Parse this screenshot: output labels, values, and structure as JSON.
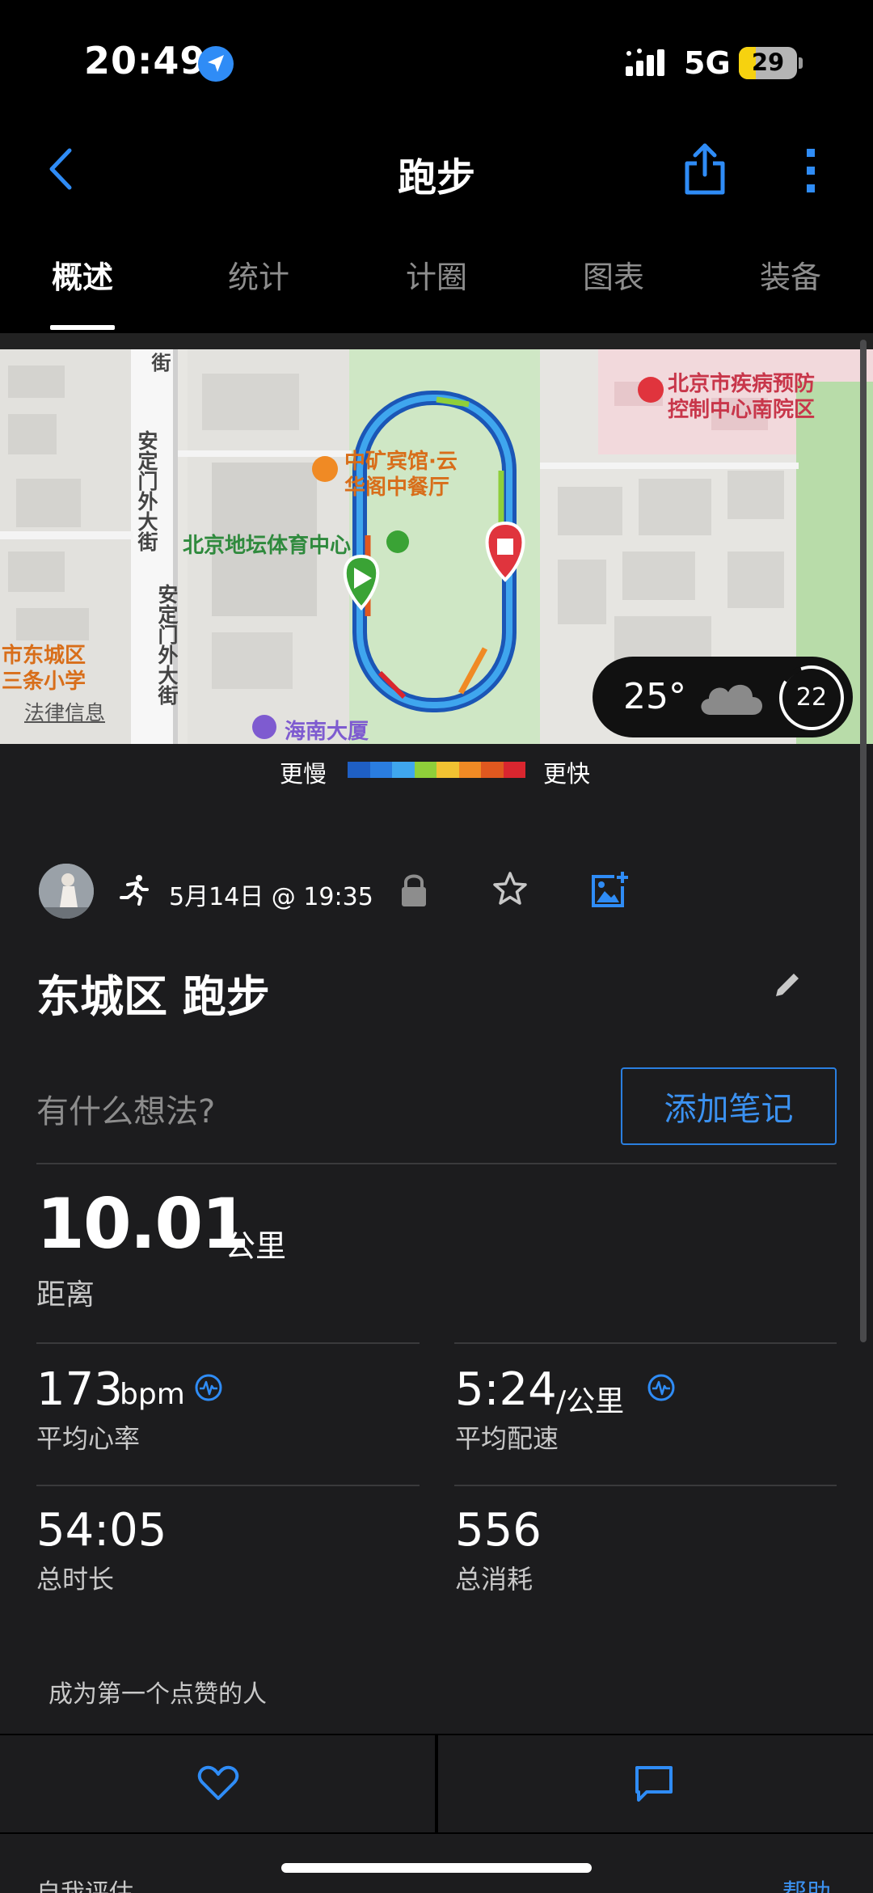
{
  "status_bar": {
    "time": "20:49",
    "network": "5G",
    "battery": "29",
    "battery_level": 0.29
  },
  "header": {
    "title": "跑步",
    "back_icon": "chevron-left-icon",
    "share_icon": "share-icon",
    "more_icon": "more-vertical-icon"
  },
  "tabs": [
    {
      "label": "概述",
      "active": true
    },
    {
      "label": "统计",
      "active": false
    },
    {
      "label": "计圈",
      "active": false
    },
    {
      "label": "图表",
      "active": false
    },
    {
      "label": "装备",
      "active": false
    }
  ],
  "map": {
    "labels": {
      "street_1": "安定门外大街",
      "street_2": "安定门外大街",
      "street_top": "街",
      "hotel": "中矿宾馆·云华阁中餐厅",
      "hotel_line1": "中矿宾馆·云",
      "hotel_line2": "华阁中餐厅",
      "stadium": "北京地坛体育中心",
      "cdc_line1": "北京市疾病预防",
      "cdc_line2": "控制中心南院区",
      "school_line1": "市东城区",
      "school_line2": "三条小学",
      "building": "海南大厦"
    },
    "legal": "法律信息",
    "weather": {
      "temp": "25°",
      "aqi": "22",
      "icon": "cloud-icon"
    }
  },
  "legend": {
    "slow": "更慢",
    "fast": "更快",
    "colors": [
      "#1f5fc4",
      "#2a7de0",
      "#3fa6ee",
      "#8fcf3a",
      "#f1c232",
      "#f08a24",
      "#e0581f",
      "#d9262f"
    ]
  },
  "activity": {
    "date": "5月14日 @ 19:35",
    "title": "东城区 跑步",
    "note_placeholder": "有什么想法?",
    "add_note": "添加笔记"
  },
  "stats": {
    "distance": {
      "value": "10.01",
      "unit": "公里",
      "label": "距离"
    },
    "avg_hr": {
      "value": "173",
      "unit": "bpm",
      "label": "平均心率"
    },
    "avg_pace": {
      "value": "5:24",
      "unit": "/公里",
      "label": "平均配速"
    },
    "duration": {
      "value": "54:05",
      "label": "总时长"
    },
    "calories": {
      "value": "556",
      "label": "总消耗"
    }
  },
  "social": {
    "like_text": "成为第一个点赞的人"
  },
  "bottom": {
    "self_eval": "自我评估",
    "help": "帮助"
  }
}
